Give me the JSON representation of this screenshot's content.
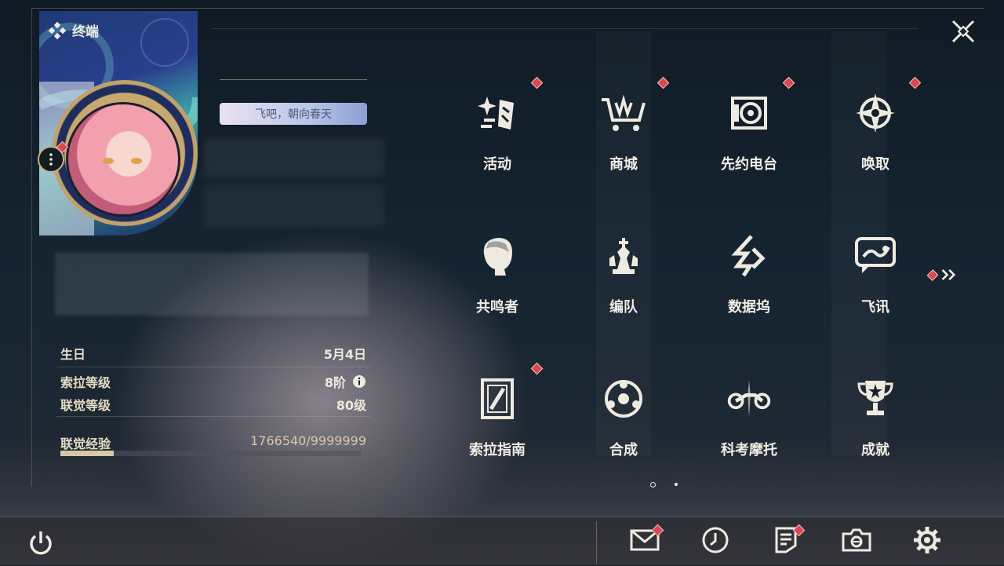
{
  "window": {
    "title": "终端"
  },
  "profile": {
    "signature": "飞吧，朝向春天",
    "birthday_label": "生日",
    "birthday_value": "5月4日",
    "sola_level_label": "索拉等级",
    "sola_level_value": "8阶",
    "union_level_label": "联觉等级",
    "union_level_value": "80级",
    "union_exp_label": "联觉经验",
    "union_exp_value": "1766540/9999999",
    "union_exp_fraction": 0.1767
  },
  "menu": {
    "items": [
      {
        "label": "活动",
        "icon": "sparkle-icon",
        "badge": true
      },
      {
        "label": "商城",
        "icon": "cart-icon",
        "badge": true
      },
      {
        "label": "先约电台",
        "icon": "radio-icon",
        "badge": true
      },
      {
        "label": "唤取",
        "icon": "compass-star-icon",
        "badge": true
      },
      {
        "label": "共鸣者",
        "icon": "character-head-icon",
        "badge": false
      },
      {
        "label": "编队",
        "icon": "chess-pieces-icon",
        "badge": false
      },
      {
        "label": "数据坞",
        "icon": "data-dock-icon",
        "badge": false
      },
      {
        "label": "飞讯",
        "icon": "chat-bubble-icon",
        "badge": false
      },
      {
        "label": "索拉指南",
        "icon": "guide-book-icon",
        "badge": true
      },
      {
        "label": "合成",
        "icon": "synthesis-icon",
        "badge": false
      },
      {
        "label": "科考摩托",
        "icon": "motorbike-icon",
        "badge": false
      },
      {
        "label": "成就",
        "icon": "trophy-icon",
        "badge": false
      }
    ],
    "page_current": 1,
    "page_total": 2
  },
  "toolbar": {
    "items": [
      {
        "icon": "mail-icon",
        "badge": true
      },
      {
        "icon": "clock-icon",
        "badge": false
      },
      {
        "icon": "notice-icon",
        "badge": true
      },
      {
        "icon": "camera-icon",
        "badge": false
      },
      {
        "icon": "settings-icon",
        "badge": false
      }
    ]
  },
  "colors": {
    "accent_gold": "#c9b287",
    "badge_red": "#d9474f",
    "text_primary": "#efeae0"
  }
}
